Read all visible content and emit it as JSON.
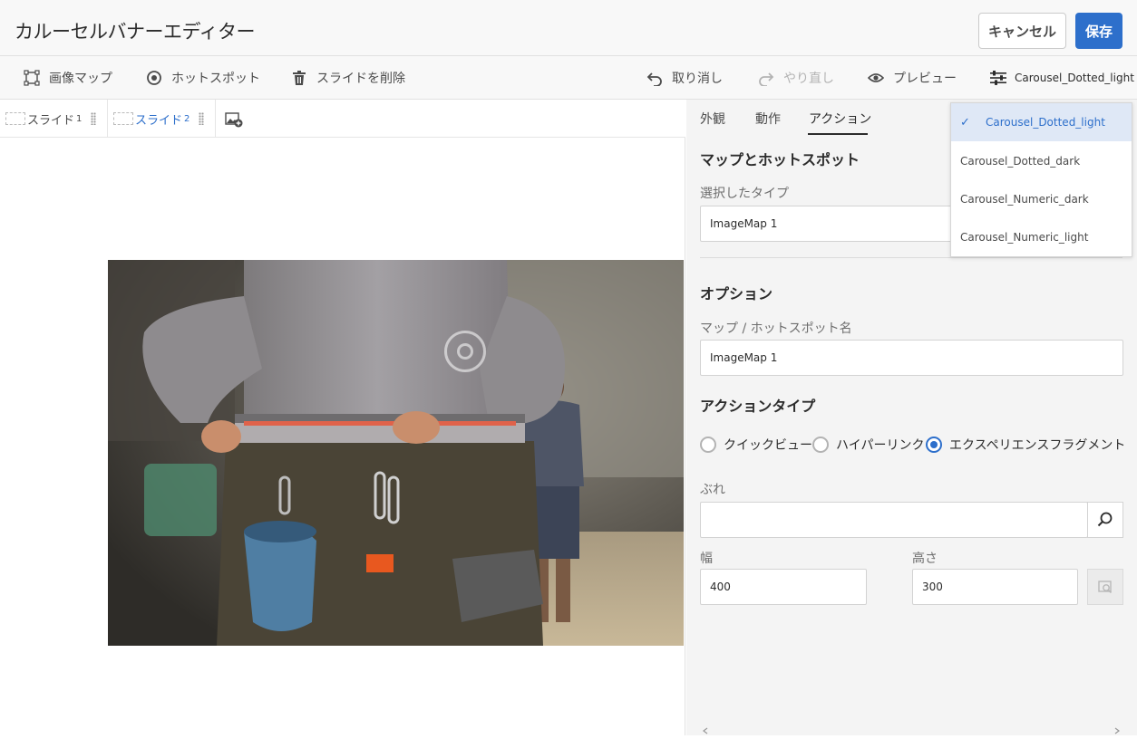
{
  "header": {
    "title": "カルーセルバナーエディター",
    "cancel_label": "キャンセル",
    "save_label": "保存"
  },
  "toolbar": {
    "image_map": "画像マップ",
    "hotspot": "ホットスポット",
    "delete_slide": "スライドを削除",
    "undo": "取り消し",
    "redo": "やり直し",
    "preview": "プレビュー",
    "style_selector": "Carousel_Dotted_light"
  },
  "slides": [
    {
      "label": "スライド",
      "num": "1"
    },
    {
      "label": "スライド",
      "num": "2"
    }
  ],
  "panel": {
    "tabs": [
      "外観",
      "動作",
      "アクション"
    ],
    "active_tab": "アクション",
    "map_section_title": "マップとホットスポット",
    "selected_type_label": "選択したタイプ",
    "selected_type_value": "ImageMap 1",
    "options_title": "オプション",
    "name_label": "マップ / ホットスポット名",
    "name_value": "ImageMap 1",
    "action_type_title": "アクションタイプ",
    "radios": [
      {
        "label": "クイックビュー",
        "checked": false
      },
      {
        "label": "ハイパーリンク",
        "checked": false
      },
      {
        "label": "エクスペリエンスフラグメント",
        "checked": true
      }
    ],
    "fragment_label": "ぶれ",
    "fragment_value": "",
    "width_label": "幅",
    "width_value": "400",
    "height_label": "高さ",
    "height_value": "300"
  },
  "dropdown": {
    "options": [
      {
        "label": "Carousel_Dotted_light",
        "selected": true
      },
      {
        "label": "Carousel_Dotted_dark",
        "selected": false
      },
      {
        "label": "Carousel_Numeric_dark",
        "selected": false
      },
      {
        "label": "Carousel_Numeric_light",
        "selected": false
      }
    ]
  },
  "colors": {
    "accent": "#2d6fcb",
    "selected_bg": "#dfe8f6"
  }
}
